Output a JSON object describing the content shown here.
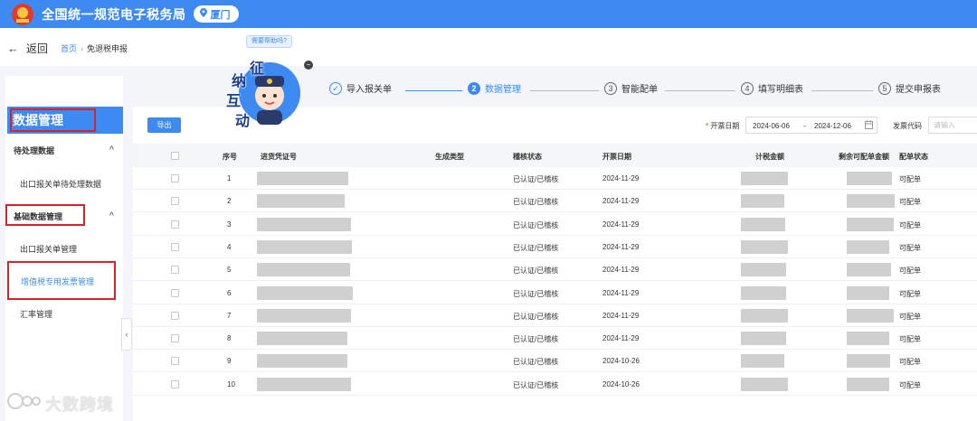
{
  "header": {
    "site_title": "全国统一规范电子税务局",
    "city": "厦门"
  },
  "nav": {
    "back_label": "返回",
    "breadcrumb_home": "首页",
    "breadcrumb_sep": "›",
    "breadcrumb_current": "免退税申报"
  },
  "assistant": {
    "help_text": "需要帮助吗?",
    "mascot_text": [
      "征",
      "纳",
      "互",
      "动"
    ]
  },
  "steps": [
    {
      "num": "✓",
      "label": "导入报关单",
      "state": "done"
    },
    {
      "num": "2",
      "label": "数据管理",
      "state": "active"
    },
    {
      "num": "3",
      "label": "智能配单",
      "state": "todo"
    },
    {
      "num": "4",
      "label": "填写明细表",
      "state": "todo"
    },
    {
      "num": "5",
      "label": "提交申报表",
      "state": "todo"
    }
  ],
  "sidebar": {
    "title": "数据管理",
    "groups": [
      {
        "label": "待处理数据",
        "items": [
          "出口报关单待处理数据"
        ]
      },
      {
        "label": "基础数据管理",
        "items": [
          "出口报关单管理",
          "增值税专用发票管理",
          "汇率管理"
        ]
      }
    ],
    "active_item": "增值税专用发票管理",
    "collapse_icon": "‹"
  },
  "toolbar": {
    "export_label": "导出",
    "date_label": "开票日期",
    "date_start": "2024-06-06",
    "date_sep": "-",
    "date_end": "2024-12-06",
    "code_label": "发票代码",
    "code_placeholder": "请输入"
  },
  "table": {
    "headers": {
      "index": "序号",
      "voucher": "进货凭证号",
      "gen_type": "生成类型",
      "check_status": "稽核状态",
      "invoice_date": "开票日期",
      "tax_amount": "计税金额",
      "remain": "剩余可配单金额",
      "match_status": "配单状态"
    },
    "rows": [
      {
        "index": "1",
        "check_status": "已认证/已稽核",
        "invoice_date": "2024-11-29",
        "match_status": "可配单"
      },
      {
        "index": "2",
        "check_status": "已认证/已稽核",
        "invoice_date": "2024-11-29",
        "match_status": "可配单"
      },
      {
        "index": "3",
        "check_status": "已认证/已稽核",
        "invoice_date": "2024-11-29",
        "match_status": "可配单"
      },
      {
        "index": "4",
        "check_status": "已认证/已稽核",
        "invoice_date": "2024-11-29",
        "match_status": "可配单"
      },
      {
        "index": "5",
        "check_status": "已认证/已稽核",
        "invoice_date": "2024-11-29",
        "match_status": "可配单"
      },
      {
        "index": "6",
        "check_status": "已认证/已稽核",
        "invoice_date": "2024-11-29",
        "match_status": "可配单"
      },
      {
        "index": "7",
        "check_status": "已认证/已稽核",
        "invoice_date": "2024-11-29",
        "match_status": "可配单"
      },
      {
        "index": "8",
        "check_status": "已认证/已稽核",
        "invoice_date": "2024-11-29",
        "match_status": "可配单"
      },
      {
        "index": "9",
        "check_status": "已认证/已稽核",
        "invoice_date": "2024-10-26",
        "match_status": "可配单"
      },
      {
        "index": "10",
        "check_status": "已认证/已稽核",
        "invoice_date": "2024-10-26",
        "match_status": "可配单"
      }
    ]
  },
  "watermark": "大数跨境",
  "colors": {
    "primary": "#3d8bf2",
    "highlight_box": "#d9232b"
  }
}
